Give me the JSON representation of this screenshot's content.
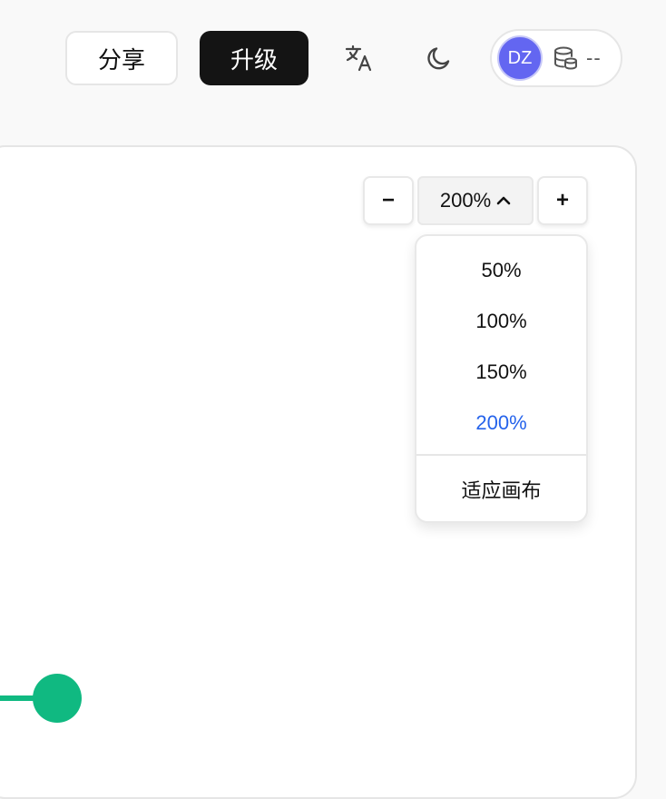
{
  "header": {
    "share_label": "分享",
    "upgrade_label": "升级",
    "translate_icon": "translate-icon",
    "theme_icon": "moon-icon",
    "account": {
      "avatar_initials": "DZ",
      "avatar_color": "#6366f1",
      "credits_icon": "database-icon",
      "credits_value": "--"
    }
  },
  "zoom": {
    "decrease_label": "−",
    "increase_label": "+",
    "current_value": "200%",
    "options": [
      {
        "label": "50%",
        "selected": false
      },
      {
        "label": "100%",
        "selected": false
      },
      {
        "label": "150%",
        "selected": false
      },
      {
        "label": "200%",
        "selected": true
      }
    ],
    "fit_label": "适应画布",
    "selected_color": "#2563eb"
  },
  "canvas": {
    "node_color": "#10b981"
  }
}
